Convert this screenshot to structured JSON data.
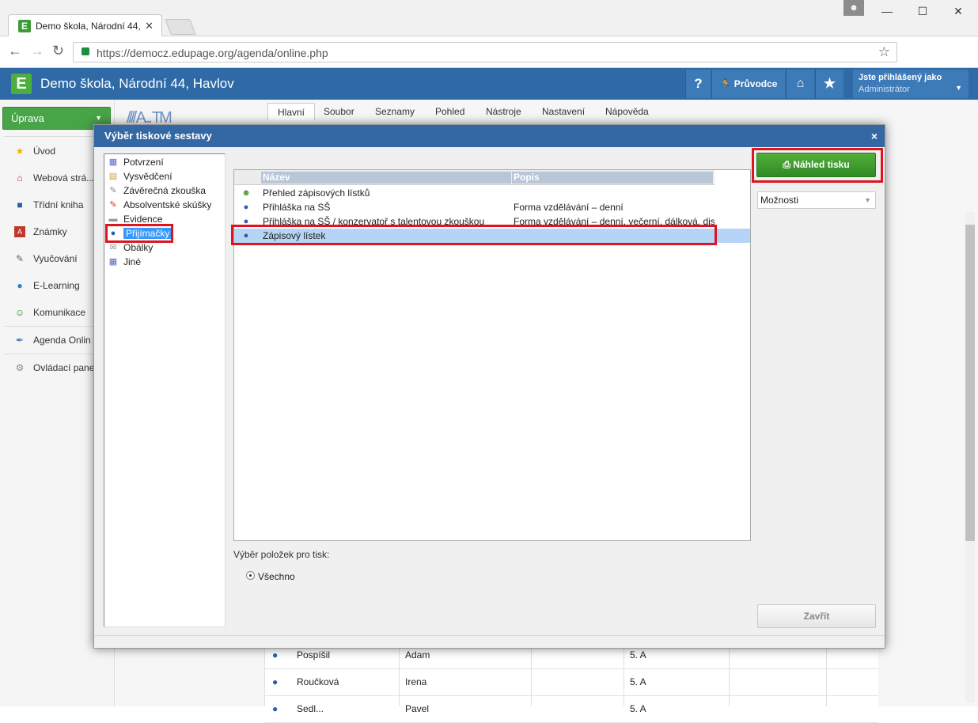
{
  "browser": {
    "tab_title": "Demo škola, Národní 44,",
    "tab_favicon": "E",
    "url": "https://democz.edupage.org/agenda/online.php",
    "controls": {
      "minimize": "—",
      "maximize": "☐",
      "close": "✕"
    }
  },
  "app": {
    "logo": "E",
    "school": "Demo škola, Národní 44, Havlov",
    "help": "?",
    "guide": "Průvodce",
    "login_line1": "Jste přihlášený jako",
    "login_line2": "Administrátor"
  },
  "sidebar": {
    "top_button": "Úprava",
    "items": [
      {
        "label": "Úvod",
        "icon": "star-icon"
      },
      {
        "label": "Webová strá...",
        "icon": "house-icon"
      },
      {
        "label": "Třídní kniha",
        "icon": "book-icon"
      },
      {
        "label": "Známky",
        "icon": "grades-icon"
      },
      {
        "label": "Vyučování",
        "icon": "teaching-icon"
      },
      {
        "label": "E-Learning",
        "icon": "globe-icon"
      },
      {
        "label": "Komunikace",
        "icon": "people-icon"
      },
      {
        "label": "Agenda Onlin",
        "icon": "pen-icon"
      },
      {
        "label": "Ovládací pane",
        "icon": "gear-icon"
      }
    ]
  },
  "ribbon": {
    "tabs": [
      "Hlavní",
      "Soubor",
      "Seznamy",
      "Pohled",
      "Nástroje",
      "Nastavení",
      "Nápověda"
    ],
    "logo_text": "////  A...  TM"
  },
  "background_table": {
    "rows": [
      {
        "surname": "Pospíšil",
        "name": "Adam",
        "class": "5. A"
      },
      {
        "surname": "Roučková",
        "name": "Irena",
        "class": "5. A"
      },
      {
        "surname": "Sedl...",
        "name": "Pavel",
        "class": "5. A"
      }
    ]
  },
  "dialog": {
    "title": "Výběr tiskové sestavy",
    "close": "×",
    "categories": [
      {
        "label": "Potvrzení",
        "icon": "certificate-icon"
      },
      {
        "label": "Vysvědčení",
        "icon": "report-icon"
      },
      {
        "label": "Závěrečná zkouška",
        "icon": "pencil-icon"
      },
      {
        "label": "Absolventské skúšky",
        "icon": "pencil-icon"
      },
      {
        "label": "Evidence",
        "icon": "evidence-icon"
      },
      {
        "label": "Přijímačky",
        "icon": "person-icon",
        "selected": true
      },
      {
        "label": "Obálky",
        "icon": "envelope-icon"
      },
      {
        "label": "Jiné",
        "icon": "certificate-icon"
      }
    ],
    "columns": {
      "name": "Název",
      "description": "Popis"
    },
    "reports": [
      {
        "name": "Přehled zápisových lístků",
        "description": "",
        "icon": "group-icon"
      },
      {
        "name": "Přihláška na SŠ",
        "description": "Forma vzdělávání – denní",
        "icon": "person-icon"
      },
      {
        "name": "Přihláška na SŠ / konzervatoř s talentovou zkouškou",
        "description": "Forma vzdělávání – denní, večerní, dálková, dis",
        "icon": "person-icon"
      },
      {
        "name": "Zápisový lístek",
        "description": "",
        "icon": "person-icon",
        "selected": true
      }
    ],
    "items_label": "Výběr položek pro tisk:",
    "radio_all": "Všechno",
    "preview_button": "Náhled tisku",
    "options_select": "Možnosti",
    "close_button": "Zavřít"
  },
  "colors": {
    "header_blue": "#2f6aa6",
    "green": "#47a447",
    "highlight_red": "#e0141e",
    "selection": "#b6d4f5"
  }
}
